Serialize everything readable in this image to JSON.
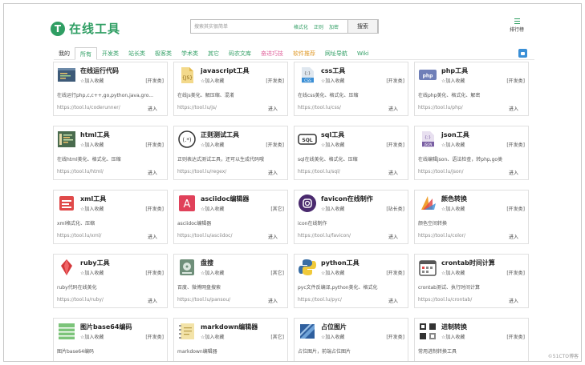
{
  "colors": {
    "brand": "#2f9e63",
    "accent_orange": "#e09b2c",
    "accent_pink": "#e0639c",
    "chat_blue": "#3a8fd6"
  },
  "header": {
    "logo_icon": "T",
    "logo_text": "在线工具",
    "search": {
      "placeholder": "搜索其实很简单",
      "links": [
        "格式化",
        "正则",
        "加密"
      ],
      "button": "搜索"
    },
    "menu": {
      "icon": "list-icon",
      "label": "排行榜"
    }
  },
  "tabs": [
    {
      "label": "我的",
      "style": "dark"
    },
    {
      "label": "所有",
      "style": "active"
    },
    {
      "label": "开发类",
      "style": "green"
    },
    {
      "label": "站长类",
      "style": "green"
    },
    {
      "label": "极客类",
      "style": "green"
    },
    {
      "label": "学术类",
      "style": "green"
    },
    {
      "label": "其它",
      "style": "green"
    },
    {
      "label": "码农文库",
      "style": "green"
    },
    {
      "label": "奋进巧技",
      "style": "pink"
    },
    {
      "label": "软件推荐",
      "style": "orange"
    },
    {
      "label": "网址导航",
      "style": "green"
    },
    {
      "label": "Wiki",
      "style": "green"
    }
  ],
  "chat_icon": "chat-icon",
  "cards": [
    {
      "title": "在线运行代码",
      "fav": "☆加入收藏",
      "cat": "[开发类]",
      "desc": "在线运行php,c,c++,go,python,java,gro...",
      "url": "https://tool.lu/coderunner/",
      "go": "进入",
      "icon": "code-editor-icon"
    },
    {
      "title": "javascript工具",
      "fav": "☆加入收藏",
      "cat": "[开发类]",
      "desc": "在线js美化、解压缩、混淆",
      "url": "https://tool.lu/js/",
      "go": "进入",
      "icon": "js-file-icon"
    },
    {
      "title": "css工具",
      "fav": "☆加入收藏",
      "cat": "[开发类]",
      "desc": "在线css美化、格式化、压缩",
      "url": "https://tool.lu/css/",
      "go": "进入",
      "icon": "css-file-icon"
    },
    {
      "title": "php工具",
      "fav": "☆加入收藏",
      "cat": "[开发类]",
      "desc": "在线php美化、格式化、解密",
      "url": "https://tool.lu/php/",
      "go": "进入",
      "icon": "php-icon"
    },
    {
      "title": "html工具",
      "fav": "☆加入收藏",
      "cat": "[开发类]",
      "desc": "在线html美化、格式化、压缩",
      "url": "https://tool.lu/html/",
      "go": "进入",
      "icon": "html-editor-icon"
    },
    {
      "title": "正则测试工具",
      "fav": "☆加入收藏",
      "cat": "[开发类]",
      "desc": "正则表达式测试工具，还可以生成代码哦",
      "url": "https://tool.lu/regex/",
      "go": "进入",
      "icon": "regex-icon"
    },
    {
      "title": "sql工具",
      "fav": "☆加入收藏",
      "cat": "[开发类]",
      "desc": "sql在线美化、格式化、压缩",
      "url": "https://tool.lu/sql/",
      "go": "进入",
      "icon": "sql-icon"
    },
    {
      "title": "json工具",
      "fav": "☆加入收藏",
      "cat": "[开发类]",
      "desc": "在线编辑json、语法检查，转php,go类",
      "url": "https://tool.lu/json/",
      "go": "进入",
      "icon": "json-file-icon"
    },
    {
      "title": "xml工具",
      "fav": "☆加入收藏",
      "cat": "[开发类]",
      "desc": "xml格式化、压缩",
      "url": "https://tool.lu/xml/",
      "go": "进入",
      "icon": "xml-file-icon"
    },
    {
      "title": "asciidoc编辑器",
      "fav": "☆加入收藏",
      "cat": "[其它]",
      "desc": "asciidoc编辑器",
      "url": "https://tool.lu/asciidoc/",
      "go": "进入",
      "icon": "asciidoc-icon"
    },
    {
      "title": "favicon在线制作",
      "fav": "☆加入收藏",
      "cat": "[站长类]",
      "desc": "icon在线制作",
      "url": "https://tool.lu/favicon/",
      "go": "进入",
      "icon": "favicon-icon"
    },
    {
      "title": "颜色转换",
      "fav": "☆加入收藏",
      "cat": "[开发类]",
      "desc": "颜色空间转换",
      "url": "https://tool.lu/color/",
      "go": "进入",
      "icon": "color-palette-icon"
    },
    {
      "title": "ruby工具",
      "fav": "☆加入收藏",
      "cat": "[开发类]",
      "desc": "ruby代码在线美化",
      "url": "https://tool.lu/ruby/",
      "go": "进入",
      "icon": "ruby-gem-icon"
    },
    {
      "title": "盘搜",
      "fav": "☆加入收藏",
      "cat": "[其它]",
      "desc": "百度、微博网盘搜索",
      "url": "https://tool.lu/pansou/",
      "go": "进入",
      "icon": "disk-search-icon"
    },
    {
      "title": "python工具",
      "fav": "☆加入收藏",
      "cat": "[开发类]",
      "desc": "pyc文件反编译,python美化、格式化",
      "url": "https://tool.lu/pyc/",
      "go": "进入",
      "icon": "python-icon"
    },
    {
      "title": "crontab时间计算",
      "fav": "☆加入收藏",
      "cat": "[开发类]",
      "desc": "crontab测试、执行时间计算",
      "url": "https://tool.lu/crontab/",
      "go": "进入",
      "icon": "crontab-icon"
    },
    {
      "title": "图片base64编码",
      "fav": "☆加入收藏",
      "cat": "[开发类]",
      "desc": "图片base64编码",
      "url": "",
      "go": "",
      "icon": "image-base64-icon"
    },
    {
      "title": "markdown编辑器",
      "fav": "☆加入收藏",
      "cat": "[其它]",
      "desc": "markdown编辑器",
      "url": "",
      "go": "",
      "icon": "markdown-notebook-icon"
    },
    {
      "title": "占位图片",
      "fav": "☆加入收藏",
      "cat": "[开发类]",
      "desc": "占位图片，前端占位图片",
      "url": "",
      "go": "",
      "icon": "placeholder-image-icon"
    },
    {
      "title": "进制转换",
      "fav": "☆加入收藏",
      "cat": "[开发类]",
      "desc": "常用进制转换工具",
      "url": "",
      "go": "",
      "icon": "base-convert-icon"
    }
  ],
  "watermark": "©51CTO博客"
}
